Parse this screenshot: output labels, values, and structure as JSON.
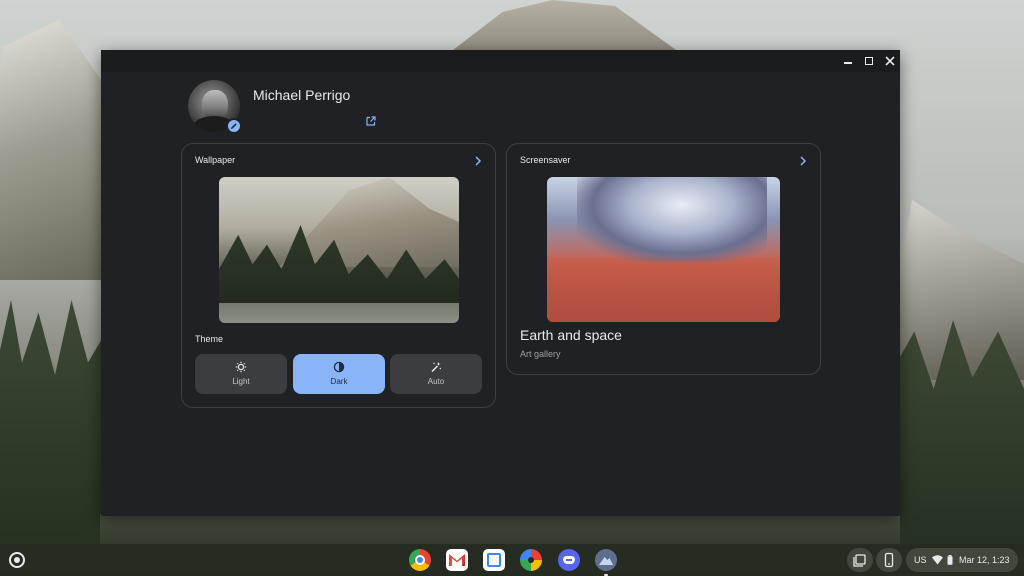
{
  "window": {
    "controls": {
      "minimize": "minimize",
      "maximize": "maximize",
      "close": "close"
    }
  },
  "profile": {
    "name": "Michael Perrigo"
  },
  "wallpaper": {
    "title": "Wallpaper"
  },
  "theme": {
    "label": "Theme",
    "options": [
      {
        "label": "Light",
        "icon": "brightness-icon",
        "selected": false
      },
      {
        "label": "Dark",
        "icon": "contrast-icon",
        "selected": true
      },
      {
        "label": "Auto",
        "icon": "magic-wand-icon",
        "selected": false
      }
    ]
  },
  "screensaver": {
    "title": "Screensaver",
    "collection": "Earth and space",
    "source": "Art gallery"
  },
  "shelf": {
    "apps": [
      "chrome-icon",
      "gmail-icon",
      "calendar-icon",
      "photos-icon",
      "discord-icon",
      "personalization-icon"
    ],
    "ime": "US",
    "clock": "Mar 12, 1:23"
  },
  "colors": {
    "accent": "#8ab4f8",
    "window_bg": "#202124",
    "card_border": "#3c4043",
    "text_primary": "#e8eaed",
    "text_secondary": "#9aa0a6"
  }
}
